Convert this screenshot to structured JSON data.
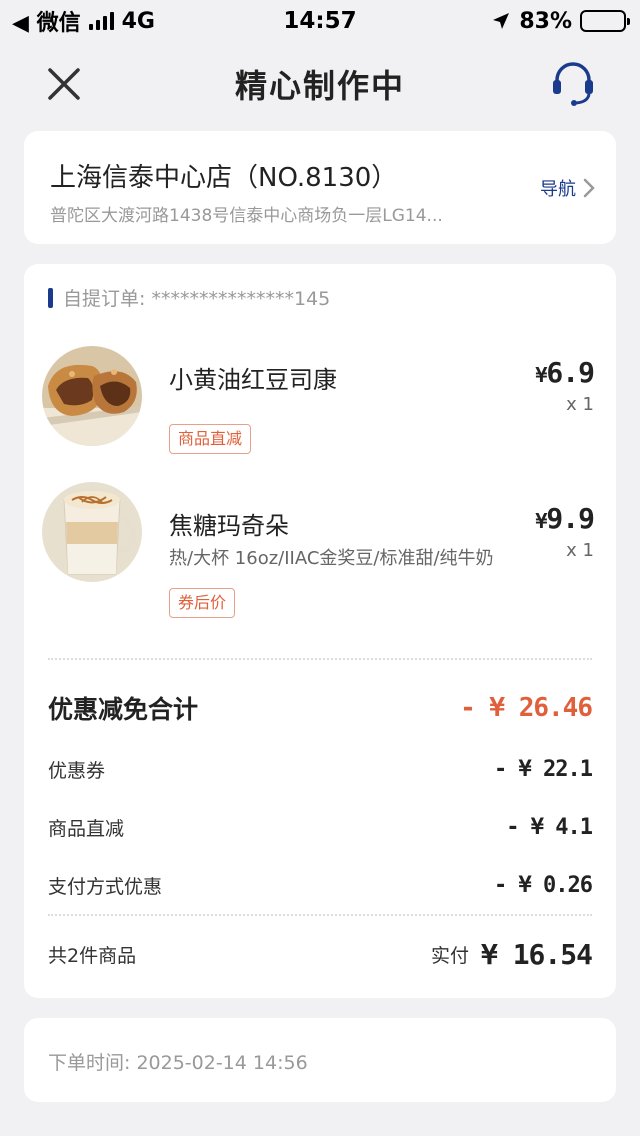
{
  "status_bar": {
    "back_app": "◀ 微信",
    "network": "4G",
    "time": "14:57",
    "battery": "83%",
    "battery_level": 0.83
  },
  "nav": {
    "title": "精心制作中",
    "close_icon": "close-icon",
    "support_icon": "headset-icon"
  },
  "store": {
    "name": "上海信泰中心店（NO.8130）",
    "address": "普陀区大渡河路1438号信泰中心商场负一层LG14...",
    "nav_label": "导航"
  },
  "order": {
    "pickup_label": "自提订单: ***************145",
    "items": [
      {
        "name": "小黄油红豆司康",
        "spec": "",
        "tag": "商品直减",
        "price": "6.9",
        "qty": "x 1"
      },
      {
        "name": "焦糖玛奇朵",
        "spec": "热/大杯 16oz/IIAC金奖豆/标准甜/纯牛奶",
        "tag": "券后价",
        "price": "9.9",
        "qty": "x 1"
      }
    ],
    "currency": "¥",
    "discount_title": "优惠减免合计",
    "discount_total": "- ¥ 26.46",
    "discounts": [
      {
        "label": "优惠券",
        "value": "- ¥ 22.1"
      },
      {
        "label": "商品直减",
        "value": "- ¥ 4.1"
      },
      {
        "label": "支付方式优惠",
        "value": "- ¥ 0.26"
      }
    ],
    "count_label": "共2件商品",
    "paid_label": "实付",
    "paid_amount": "¥ 16.54"
  },
  "order_time": "下单时间:  2025-02-14 14:56",
  "colors": {
    "accent_blue": "#1a3a8c",
    "discount_orange": "#e0603c"
  }
}
